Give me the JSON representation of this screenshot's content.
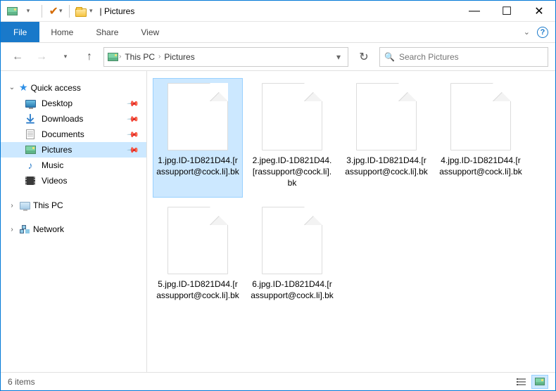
{
  "titlebar": {
    "title": "Pictures",
    "separator": "|"
  },
  "window_controls": {
    "minimize": "—",
    "maximize": "☐",
    "close": "✕"
  },
  "ribbon": {
    "file": "File",
    "tabs": [
      "Home",
      "Share",
      "View"
    ],
    "help_tip": "?"
  },
  "nav": {
    "back": "←",
    "forward": "→",
    "up": "↑",
    "breadcrumb": [
      "This PC",
      "Pictures"
    ],
    "dropdown": "▾",
    "refresh": "↻"
  },
  "search": {
    "placeholder": "Search Pictures",
    "icon": "🔍"
  },
  "sidebar": {
    "quick_access": {
      "label": "Quick access",
      "items": [
        {
          "label": "Desktop",
          "pinned": true,
          "icon": "monitor"
        },
        {
          "label": "Downloads",
          "pinned": true,
          "icon": "download"
        },
        {
          "label": "Documents",
          "pinned": true,
          "icon": "document"
        },
        {
          "label": "Pictures",
          "pinned": true,
          "icon": "pictures",
          "active": true
        },
        {
          "label": "Music",
          "pinned": false,
          "icon": "music"
        },
        {
          "label": "Videos",
          "pinned": false,
          "icon": "videos"
        }
      ]
    },
    "this_pc": {
      "label": "This PC"
    },
    "network": {
      "label": "Network"
    }
  },
  "files": [
    {
      "name": "1.jpg.ID-1D821D44.[rassupport@cock.li].bk",
      "selected": true
    },
    {
      "name": "2.jpeg.ID-1D821D44.[rassupport@cock.li].bk",
      "selected": false
    },
    {
      "name": "3.jpg.ID-1D821D44.[rassupport@cock.li].bk",
      "selected": false
    },
    {
      "name": "4.jpg.ID-1D821D44.[rassupport@cock.li].bk",
      "selected": false
    },
    {
      "name": "5.jpg.ID-1D821D44.[rassupport@cock.li].bk",
      "selected": false
    },
    {
      "name": "6.jpg.ID-1D821D44.[rassupport@cock.li].bk",
      "selected": false
    }
  ],
  "statusbar": {
    "count_text": "6 items"
  }
}
